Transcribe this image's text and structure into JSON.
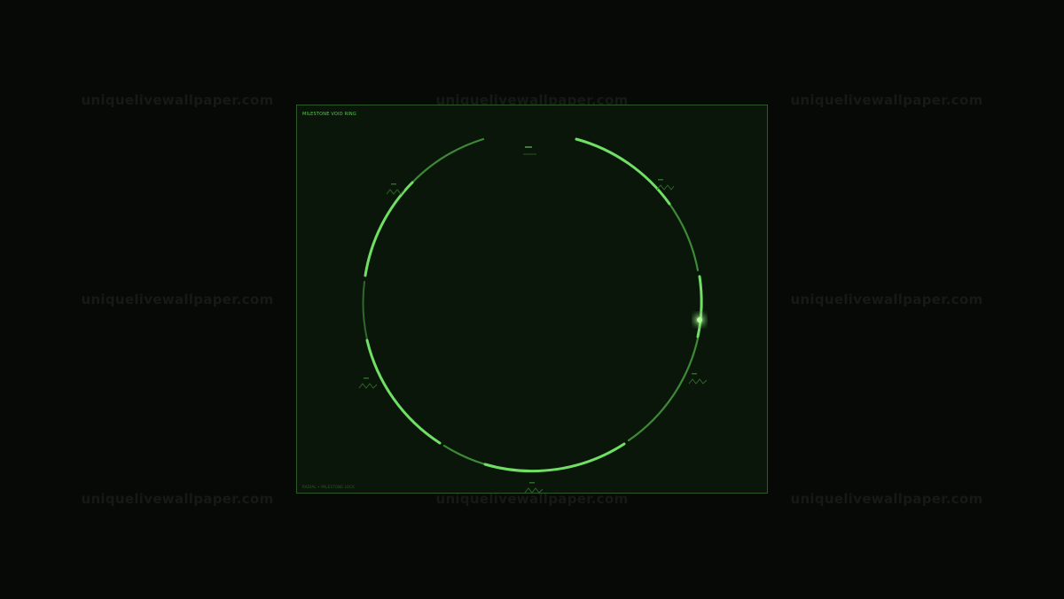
{
  "watermark": {
    "text": "uniquelivewallpaper.com"
  },
  "panel": {
    "title": "MILESTONE VOID RING",
    "footer": "RADIAL • MILESTONE LOCK"
  },
  "ring": {
    "top_marker_label": "",
    "colors": {
      "bright": "#6fe063",
      "dim": "#3d8a35",
      "marker": "#2f6a2a"
    }
  },
  "icons": {
    "waveform": "zigzag-marker-icon",
    "cursor": "glow-cursor-icon"
  }
}
